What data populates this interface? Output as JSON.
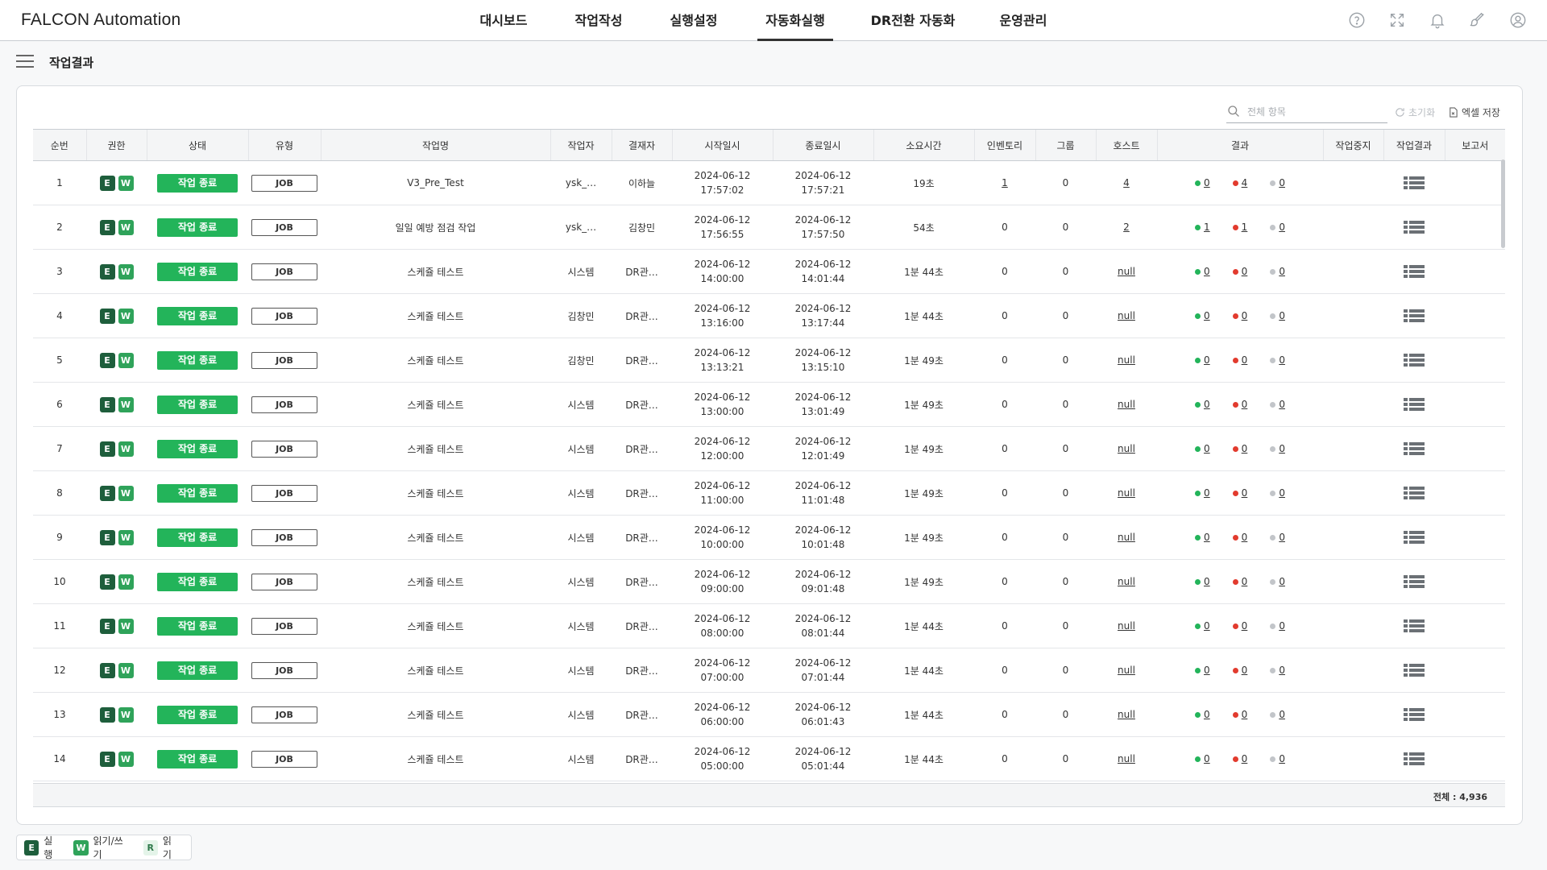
{
  "app": {
    "title": "FALCON Automation"
  },
  "nav": [
    {
      "label": "대시보드",
      "active": false
    },
    {
      "label": "작업작성",
      "active": false
    },
    {
      "label": "실행설정",
      "active": false
    },
    {
      "label": "자동화실행",
      "active": true
    },
    {
      "label": "DR전환 자동화",
      "active": false
    },
    {
      "label": "운영관리",
      "active": false
    }
  ],
  "top_icons": [
    "help-icon",
    "fullscreen-icon",
    "bell-icon",
    "brush-icon",
    "user-icon"
  ],
  "page": {
    "title": "작업결과"
  },
  "toolbar": {
    "search_placeholder": "전체 항목",
    "reset_label": "초기화",
    "excel_label": "엑셀 저장"
  },
  "columns": [
    "순번",
    "권한",
    "상태",
    "유형",
    "작업명",
    "작업자",
    "결재자",
    "시작일시",
    "종료일시",
    "소요시간",
    "인벤토리",
    "그룹",
    "호스트",
    "결과",
    "작업중지",
    "작업결과",
    "보고서"
  ],
  "rows": [
    {
      "no": "1",
      "perms": [
        "E",
        "W"
      ],
      "status": "작업 종료",
      "type": "JOB",
      "name": "V3_Pre_Test",
      "worker": "ysk_…",
      "approver": "이하늘",
      "start_date": "2024-06-12",
      "start_time": "17:57:02",
      "end_date": "2024-06-12",
      "end_time": "17:57:21",
      "duration": "19초",
      "inventory": "1",
      "inventory_link": true,
      "group": "0",
      "host": "4",
      "result_ok": "0",
      "result_fail": "4",
      "result_skip": "0"
    },
    {
      "no": "2",
      "perms": [
        "E",
        "W"
      ],
      "status": "작업 종료",
      "type": "JOB",
      "name": "일일 예방 점검 작업",
      "worker": "ysk_…",
      "approver": "김창민",
      "start_date": "2024-06-12",
      "start_time": "17:56:55",
      "end_date": "2024-06-12",
      "end_time": "17:57:50",
      "duration": "54초",
      "inventory": "0",
      "inventory_link": false,
      "group": "0",
      "host": "2",
      "result_ok": "1",
      "result_fail": "1",
      "result_skip": "0"
    },
    {
      "no": "3",
      "perms": [
        "E",
        "W"
      ],
      "status": "작업 종료",
      "type": "JOB",
      "name": "스케쥴 테스트",
      "worker": "시스템",
      "approver": "DR관…",
      "start_date": "2024-06-12",
      "start_time": "14:00:00",
      "end_date": "2024-06-12",
      "end_time": "14:01:44",
      "duration": "1분 44초",
      "inventory": "0",
      "inventory_link": false,
      "group": "0",
      "host": "null",
      "result_ok": "0",
      "result_fail": "0",
      "result_skip": "0"
    },
    {
      "no": "4",
      "perms": [
        "E",
        "W"
      ],
      "status": "작업 종료",
      "type": "JOB",
      "name": "스케쥴 테스트",
      "worker": "김창민",
      "approver": "DR관…",
      "start_date": "2024-06-12",
      "start_time": "13:16:00",
      "end_date": "2024-06-12",
      "end_time": "13:17:44",
      "duration": "1분 44초",
      "inventory": "0",
      "inventory_link": false,
      "group": "0",
      "host": "null",
      "result_ok": "0",
      "result_fail": "0",
      "result_skip": "0"
    },
    {
      "no": "5",
      "perms": [
        "E",
        "W"
      ],
      "status": "작업 종료",
      "type": "JOB",
      "name": "스케쥴 테스트",
      "worker": "김창민",
      "approver": "DR관…",
      "start_date": "2024-06-12",
      "start_time": "13:13:21",
      "end_date": "2024-06-12",
      "end_time": "13:15:10",
      "duration": "1분 49초",
      "inventory": "0",
      "inventory_link": false,
      "group": "0",
      "host": "null",
      "result_ok": "0",
      "result_fail": "0",
      "result_skip": "0"
    },
    {
      "no": "6",
      "perms": [
        "E",
        "W"
      ],
      "status": "작업 종료",
      "type": "JOB",
      "name": "스케쥴 테스트",
      "worker": "시스템",
      "approver": "DR관…",
      "start_date": "2024-06-12",
      "start_time": "13:00:00",
      "end_date": "2024-06-12",
      "end_time": "13:01:49",
      "duration": "1분 49초",
      "inventory": "0",
      "inventory_link": false,
      "group": "0",
      "host": "null",
      "result_ok": "0",
      "result_fail": "0",
      "result_skip": "0"
    },
    {
      "no": "7",
      "perms": [
        "E",
        "W"
      ],
      "status": "작업 종료",
      "type": "JOB",
      "name": "스케쥴 테스트",
      "worker": "시스템",
      "approver": "DR관…",
      "start_date": "2024-06-12",
      "start_time": "12:00:00",
      "end_date": "2024-06-12",
      "end_time": "12:01:49",
      "duration": "1분 49초",
      "inventory": "0",
      "inventory_link": false,
      "group": "0",
      "host": "null",
      "result_ok": "0",
      "result_fail": "0",
      "result_skip": "0"
    },
    {
      "no": "8",
      "perms": [
        "E",
        "W"
      ],
      "status": "작업 종료",
      "type": "JOB",
      "name": "스케쥴 테스트",
      "worker": "시스템",
      "approver": "DR관…",
      "start_date": "2024-06-12",
      "start_time": "11:00:00",
      "end_date": "2024-06-12",
      "end_time": "11:01:48",
      "duration": "1분 49초",
      "inventory": "0",
      "inventory_link": false,
      "group": "0",
      "host": "null",
      "result_ok": "0",
      "result_fail": "0",
      "result_skip": "0"
    },
    {
      "no": "9",
      "perms": [
        "E",
        "W"
      ],
      "status": "작업 종료",
      "type": "JOB",
      "name": "스케쥴 테스트",
      "worker": "시스템",
      "approver": "DR관…",
      "start_date": "2024-06-12",
      "start_time": "10:00:00",
      "end_date": "2024-06-12",
      "end_time": "10:01:48",
      "duration": "1분 49초",
      "inventory": "0",
      "inventory_link": false,
      "group": "0",
      "host": "null",
      "result_ok": "0",
      "result_fail": "0",
      "result_skip": "0"
    },
    {
      "no": "10",
      "perms": [
        "E",
        "W"
      ],
      "status": "작업 종료",
      "type": "JOB",
      "name": "스케쥴 테스트",
      "worker": "시스템",
      "approver": "DR관…",
      "start_date": "2024-06-12",
      "start_time": "09:00:00",
      "end_date": "2024-06-12",
      "end_time": "09:01:48",
      "duration": "1분 49초",
      "inventory": "0",
      "inventory_link": false,
      "group": "0",
      "host": "null",
      "result_ok": "0",
      "result_fail": "0",
      "result_skip": "0"
    },
    {
      "no": "11",
      "perms": [
        "E",
        "W"
      ],
      "status": "작업 종료",
      "type": "JOB",
      "name": "스케쥴 테스트",
      "worker": "시스템",
      "approver": "DR관…",
      "start_date": "2024-06-12",
      "start_time": "08:00:00",
      "end_date": "2024-06-12",
      "end_time": "08:01:44",
      "duration": "1분 44초",
      "inventory": "0",
      "inventory_link": false,
      "group": "0",
      "host": "null",
      "result_ok": "0",
      "result_fail": "0",
      "result_skip": "0"
    },
    {
      "no": "12",
      "perms": [
        "E",
        "W"
      ],
      "status": "작업 종료",
      "type": "JOB",
      "name": "스케쥴 테스트",
      "worker": "시스템",
      "approver": "DR관…",
      "start_date": "2024-06-12",
      "start_time": "07:00:00",
      "end_date": "2024-06-12",
      "end_time": "07:01:44",
      "duration": "1분 44초",
      "inventory": "0",
      "inventory_link": false,
      "group": "0",
      "host": "null",
      "result_ok": "0",
      "result_fail": "0",
      "result_skip": "0"
    },
    {
      "no": "13",
      "perms": [
        "E",
        "W"
      ],
      "status": "작업 종료",
      "type": "JOB",
      "name": "스케쥴 테스트",
      "worker": "시스템",
      "approver": "DR관…",
      "start_date": "2024-06-12",
      "start_time": "06:00:00",
      "end_date": "2024-06-12",
      "end_time": "06:01:43",
      "duration": "1분 44초",
      "inventory": "0",
      "inventory_link": false,
      "group": "0",
      "host": "null",
      "result_ok": "0",
      "result_fail": "0",
      "result_skip": "0"
    },
    {
      "no": "14",
      "perms": [
        "E",
        "W"
      ],
      "status": "작업 종료",
      "type": "JOB",
      "name": "스케쥴 테스트",
      "worker": "시스템",
      "approver": "DR관…",
      "start_date": "2024-06-12",
      "start_time": "05:00:00",
      "end_date": "2024-06-12",
      "end_time": "05:01:44",
      "duration": "1분 44초",
      "inventory": "0",
      "inventory_link": false,
      "group": "0",
      "host": "null",
      "result_ok": "0",
      "result_fail": "0",
      "result_skip": "0"
    }
  ],
  "footer": {
    "total": "전체 : 4,936"
  },
  "legend": [
    {
      "badge": "E",
      "label": "실행"
    },
    {
      "badge": "W",
      "label": "읽기/쓰기"
    },
    {
      "badge": "R",
      "label": "읽기"
    }
  ],
  "colors": {
    "status_done": "#23b45a",
    "perm_e": "#1e5e3c",
    "perm_w": "#2fa35a",
    "result_ok": "#23b45a",
    "result_fail": "#e23b2e",
    "result_skip": "#c2c5c9"
  }
}
